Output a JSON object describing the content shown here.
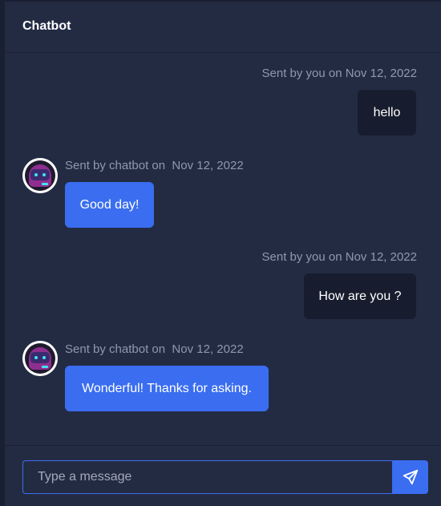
{
  "header": {
    "title": "Chatbot"
  },
  "messages": [
    {
      "sender": "user",
      "meta": "Sent by you on Nov 12, 2022",
      "text": "hello"
    },
    {
      "sender": "bot",
      "meta": "Sent by chatbot on  Nov 12, 2022",
      "text": "Good day!"
    },
    {
      "sender": "user",
      "meta": "Sent by you on Nov 12, 2022",
      "text": "How are you ?"
    },
    {
      "sender": "bot",
      "meta": "Sent by chatbot on  Nov 12, 2022",
      "text": "Wonderful! Thanks for asking."
    }
  ],
  "composer": {
    "placeholder": "Type a message",
    "send_icon": "send-icon"
  },
  "colors": {
    "accent": "#3a6df0",
    "user_bubble": "#171d2e",
    "panel": "#232b43"
  }
}
